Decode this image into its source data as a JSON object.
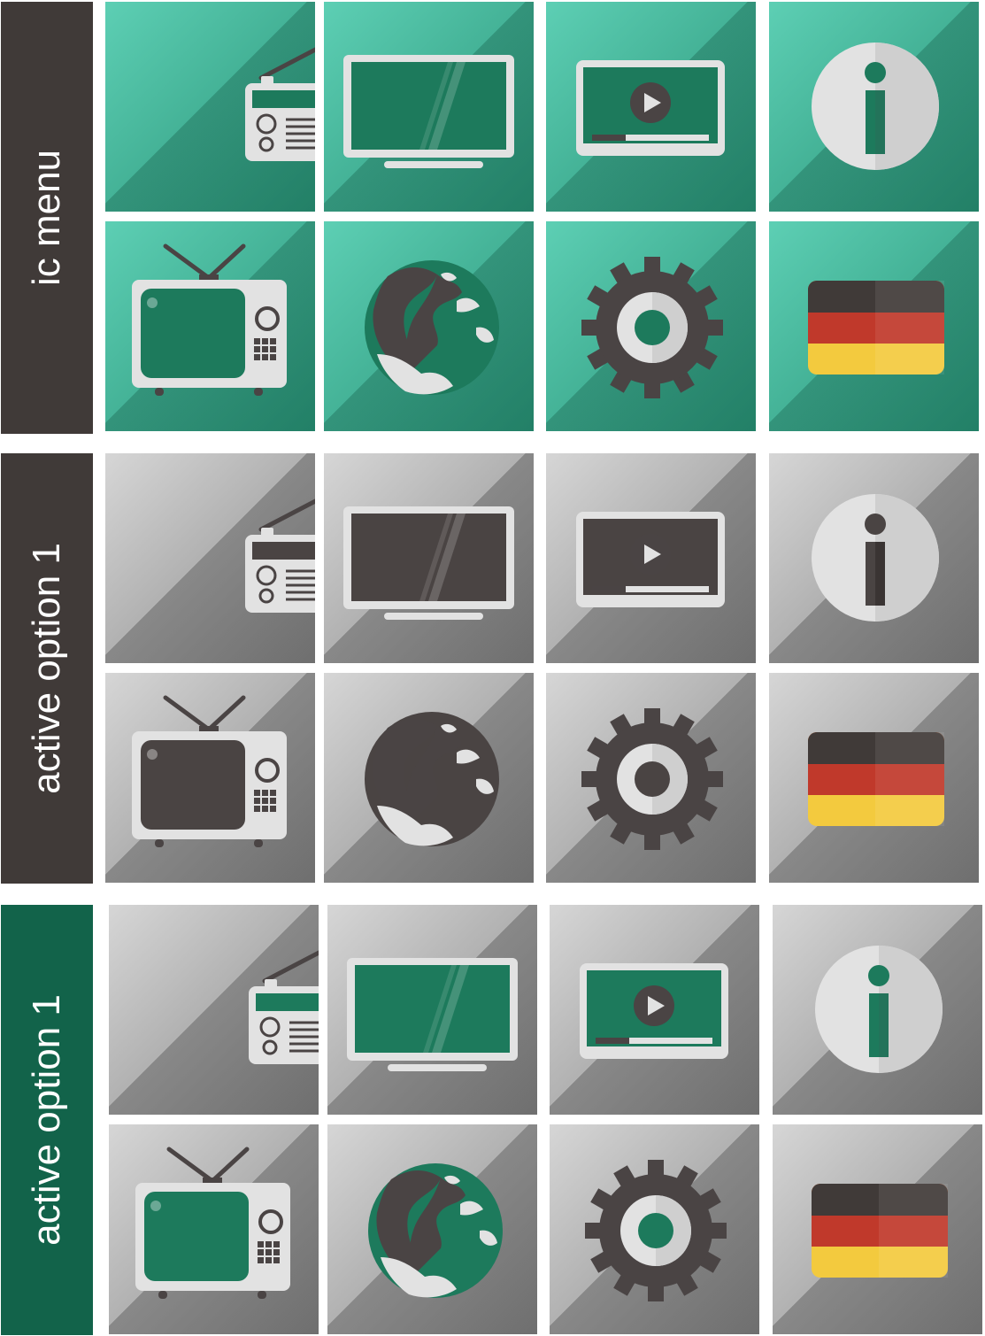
{
  "sections": [
    {
      "label": "ic menu",
      "label_bg": "#403a38",
      "tile_light": "#5dcfb4",
      "tile_dark": "#2a9478",
      "shadow": "rgba(20,90,70,0.35)",
      "accent": "#1d7a5c",
      "accent_dark": "#23735a",
      "gear": "#4a4444"
    },
    {
      "label": "active option 1",
      "label_bg": "#403a38",
      "tile_light": "#d6d6d6",
      "tile_dark": "#8a8a8a",
      "shadow": "rgba(60,60,60,0.35)",
      "accent": "#4a4443",
      "accent_dark": "#3a3433",
      "gear": "#4a4444"
    },
    {
      "label": "active option 1",
      "label_bg": "#12634a",
      "tile_light": "#d6d6d6",
      "tile_dark": "#8a8a8a",
      "shadow": "rgba(60,60,60,0.35)",
      "accent": "#1d7a5c",
      "accent_dark": "#23735a",
      "gear": "#4a4444"
    }
  ],
  "icons": [
    "radio-icon",
    "monitor-icon",
    "video-player-icon",
    "info-icon",
    "tv-icon",
    "globe-icon",
    "gear-icon",
    "germany-flag-icon"
  ],
  "flag_colors": {
    "black": "#403a38",
    "red": "#c0392b",
    "gold": "#f3ca3e"
  },
  "light_gray": "#e2e2e2"
}
